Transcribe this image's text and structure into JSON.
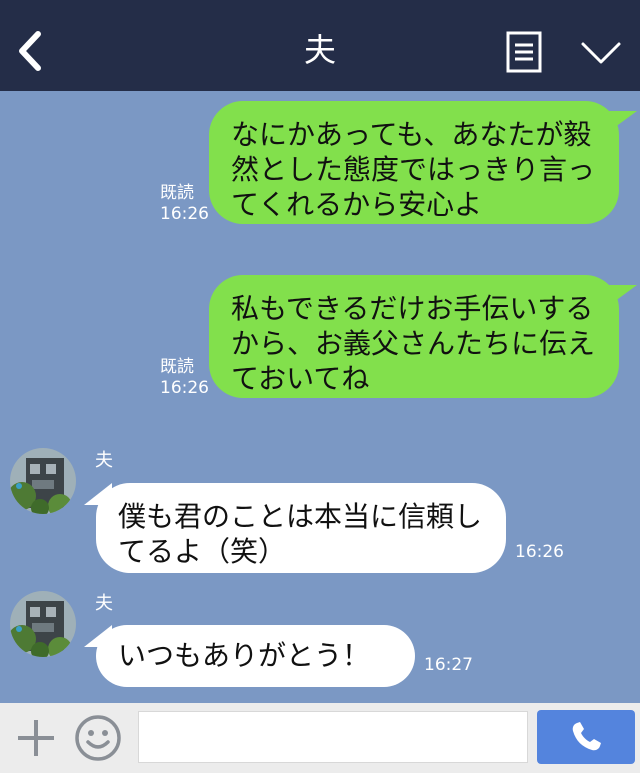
{
  "header": {
    "title": "夫",
    "back_icon": "chevron-left-icon",
    "menu_icon": "note-list-icon",
    "collapse_icon": "chevron-down-icon"
  },
  "messages": [
    {
      "side": "me",
      "text": "なにかあっても、あなたが毅然とした態度ではっきり言ってくれるから安心よ",
      "read": "既読",
      "time": "16:26"
    },
    {
      "side": "me",
      "text": "私もできるだけお手伝いするから、お義父さんたちに伝えておいてね",
      "read": "既読",
      "time": "16:26"
    },
    {
      "side": "them",
      "sender": "夫",
      "text": "僕も君のことは本当に信頼してるよ（笑）",
      "time": "16:26"
    },
    {
      "side": "them",
      "sender": "夫",
      "text": "いつもありがとう！",
      "time": "16:27"
    }
  ],
  "input_bar": {
    "plus_icon": "plus-icon",
    "emoji_icon": "smiley-icon",
    "message_placeholder": "",
    "call_icon": "phone-icon"
  },
  "colors": {
    "header_bg": "#242d48",
    "chat_bg": "#7b98c4",
    "my_bubble": "#82e04c",
    "their_bubble": "#ffffff",
    "call_button": "#5484dd"
  }
}
